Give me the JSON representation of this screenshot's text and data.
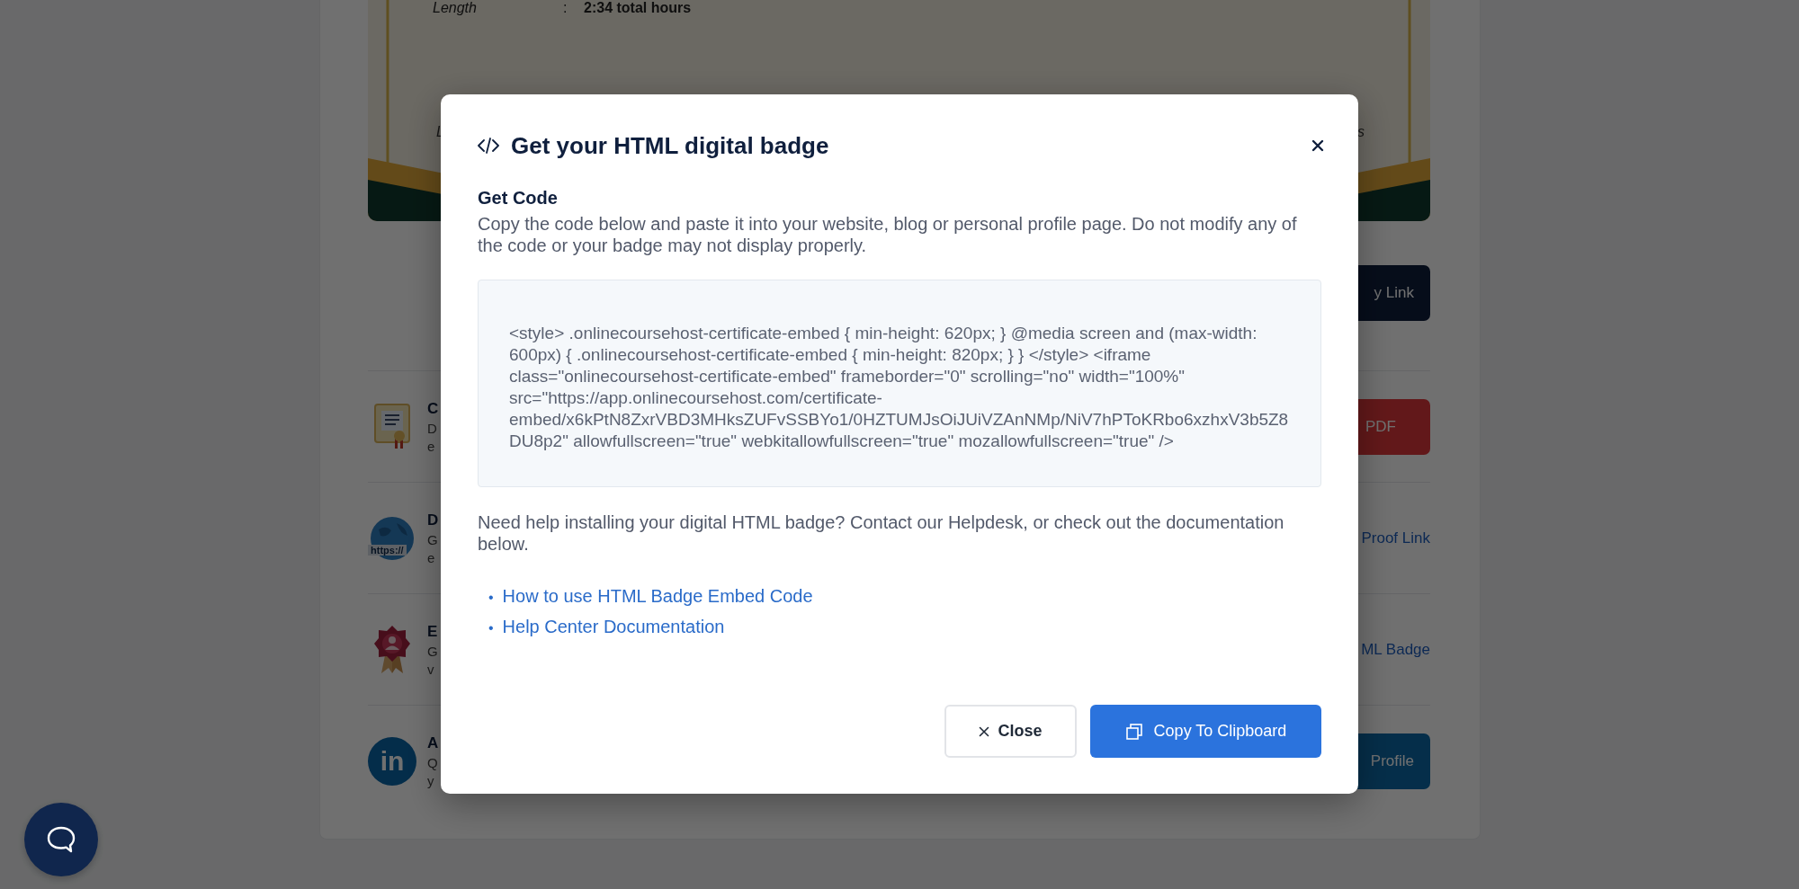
{
  "certificate": {
    "length_label": "Length",
    "separator": ":",
    "length_value": "2:34 total hours",
    "left_fragment": "L",
    "right_fragment": "s"
  },
  "top_action": {
    "label": "y Link"
  },
  "rows": [
    {
      "kind": "certificate",
      "title": "C",
      "description": [
        "D",
        "e"
      ],
      "action": {
        "kind": "danger",
        "label": "PDF"
      }
    },
    {
      "kind": "globe",
      "icon_label": "https://",
      "title": "D",
      "description": [
        "G",
        "e"
      ],
      "action": {
        "kind": "link",
        "label": "Proof Link"
      }
    },
    {
      "kind": "ribbon",
      "title": "E",
      "description": [
        "G",
        "v"
      ],
      "action": {
        "kind": "link",
        "label": "ML Badge"
      }
    },
    {
      "kind": "linkedin",
      "icon_label": "in",
      "title": "A",
      "description": [
        "Q",
        "y"
      ],
      "action": {
        "kind": "primary",
        "label": "Profile"
      }
    }
  ],
  "modal": {
    "title": "Get your HTML digital badge",
    "section_title": "Get Code",
    "intro": "Copy the code below and paste it into your website, blog or personal profile page. Do not modify any of the code or your badge may not display properly.",
    "code": "<style> .onlinecoursehost-certificate-embed { min-height: 620px; } @media screen and (max-width: 600px) { .onlinecoursehost-certificate-embed { min-height: 820px; } } </style> <iframe class=\"onlinecoursehost-certificate-embed\" frameborder=\"0\" scrolling=\"no\" width=\"100%\" src=\"https://app.onlinecoursehost.com/certificate-embed/x6kPtN8ZxrVBD3MHksZUFvSSBYo1/0HZTUMJsOiJUiVZAnNMp/NiV7hPToKRbo6xzhxV3b5Z8DU8p2\" allowfullscreen=\"true\" webkitallowfullscreen=\"true\" mozallowfullscreen=\"true\" />",
    "help": "Need help installing your digital HTML badge? Contact our Helpdesk, or check out the documentation below.",
    "links": [
      {
        "bullet": "•",
        "label": "How to use HTML Badge Embed Code"
      },
      {
        "bullet": "•",
        "label": "Help Center Documentation"
      }
    ],
    "close_label": "Close",
    "copy_label": "Copy To Clipboard"
  }
}
